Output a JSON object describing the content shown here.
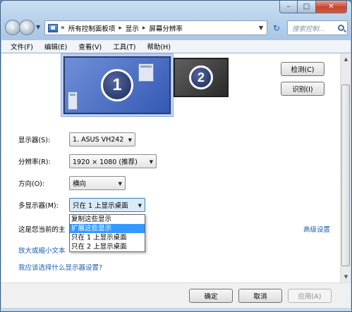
{
  "window": {
    "caption": {
      "minimize": "–",
      "maximize": "□",
      "close": "✕"
    }
  },
  "nav": {
    "back": "‹",
    "forward": "›",
    "address_prefix": "«",
    "breadcrumbs": [
      "所有控制面板项",
      "显示",
      "屏幕分辨率"
    ],
    "crumb_sep": "▸",
    "refresh": "↻",
    "search_placeholder": "搜索控制..."
  },
  "menu": [
    "文件(F)",
    "编辑(E)",
    "查看(V)",
    "工具(T)",
    "帮助(H)"
  ],
  "monitors": [
    {
      "number": "1",
      "selected": true
    },
    {
      "number": "2",
      "selected": false
    }
  ],
  "buttons": {
    "detect": "检测(C)",
    "identify": "识别(I)",
    "ok": "确定",
    "cancel": "取消",
    "apply": "应用(A)"
  },
  "settings": {
    "display": {
      "label": "显示器(S):",
      "value": "1. ASUS VH242"
    },
    "resolution": {
      "label": "分辨率(R):",
      "value": "1920 × 1080 (推荐)"
    },
    "orientation": {
      "label": "方向(O):",
      "value": "横向"
    },
    "multi": {
      "label": "多显示器(M):",
      "value": "只在 1 上显示桌面",
      "options": [
        "复制这些显示",
        "扩展这些显示",
        "只在 1 上显示桌面",
        "只在 2 上显示桌面"
      ],
      "highlighted": "扩展这些显示"
    }
  },
  "status_text": "这是您当前的主",
  "advanced_link": "高级设置",
  "link_text_size": "放大或缩小文本",
  "link_which_display": "我应该选择什么显示器设置?",
  "colors": {
    "link": "#1e5fab",
    "highlight": "#3399ff",
    "monitor1": "#3559b3"
  }
}
